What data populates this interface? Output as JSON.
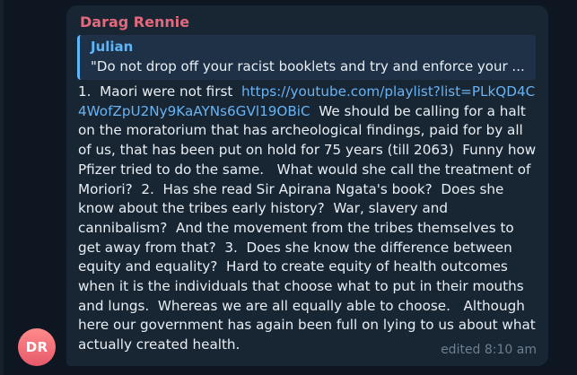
{
  "message": {
    "sender_name": "Darag Rennie",
    "avatar_initials": "DR",
    "reply": {
      "name": "Julian",
      "text": "\"Do not drop off your racist booklets and try and enforce your ..."
    },
    "text_before_link": "1.  Maori were not first  ",
    "link_text": "https://youtube.com/playlist?list=PLkQD4C4WofZpU2Ny9KaAYNs6GVl19OBiC",
    "text_after_link": "  We should be calling for a halt on the moratorium that has archeological findings, paid for by all of us, that has been put on hold for 75 years (till 2063)  Funny how Pfizer tried to do the same.   What would she call the treatment of Moriori?  2.  Has she read Sir Apirana Ngata's book?  Does she know about the tribes early history?  War, slavery and cannibalism?  And the movement from the tribes themselves to get away from that?  3.  Does she know the difference between equity and equality?  Hard to create equity of health outcomes when it is the individuals that choose what to put in their mouths and lungs.  Whereas we are all equally able to choose.   Although here our government has again been full on lying to us about what actually created health.",
    "edited_time": "edited 8:10 am"
  },
  "colors": {
    "background": "#0e1621",
    "bubble": "#182533",
    "sender_name": "#e36a7d",
    "reply_accent": "#5eb5f7",
    "link": "#6ab3f3",
    "meta": "#6d7f8f"
  }
}
